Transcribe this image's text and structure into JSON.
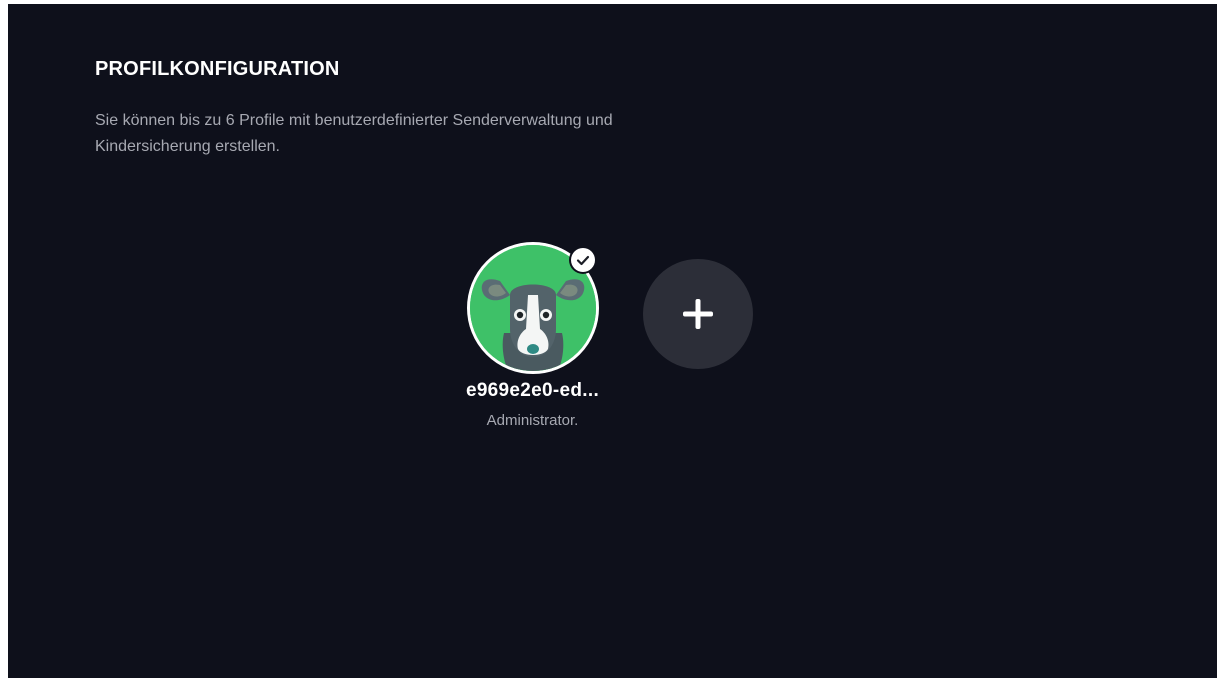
{
  "page": {
    "title": "PROFILKONFIGURATION",
    "description": "Sie können bis zu 6 Profile mit benutzerdefinierter Senderverwaltung und Kindersicherung erstellen."
  },
  "profiles": [
    {
      "name": "e969e2e0-ed...",
      "role": "Administrator.",
      "avatar_icon": "dog-avatar-icon",
      "avatar_background": "#3ec168",
      "selected": true
    }
  ],
  "add_profile": {
    "icon": "plus-icon"
  },
  "colors": {
    "background": "#0e101b",
    "button_background": "#2c2e38",
    "text_primary": "#ffffff",
    "text_secondary": "#a7a9b2"
  }
}
